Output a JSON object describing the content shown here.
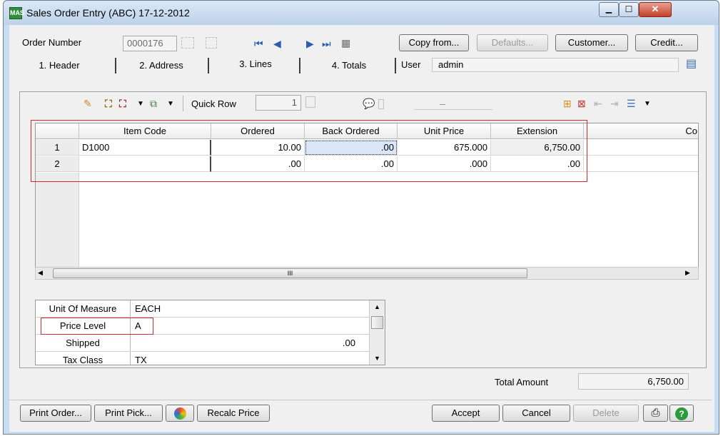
{
  "window": {
    "title": "Sales Order Entry (ABC) 17-12-2012",
    "app_icon": "MAS",
    "min_glyph": "▁",
    "max_glyph": "☐",
    "close_glyph": "✕"
  },
  "header": {
    "order_label": "Order Number",
    "order_number": "0000176",
    "buttons": {
      "copy_from": "Copy from...",
      "defaults": "Defaults...",
      "customer": "Customer...",
      "credit": "Credit..."
    },
    "user_label": "User",
    "user_value": "admin"
  },
  "tabs": [
    "1. Header",
    "2. Address",
    "3. Lines",
    "4. Totals"
  ],
  "toolbar": {
    "quick_row_label": "Quick Row",
    "quick_row_value": "1"
  },
  "lines": {
    "columns": [
      "",
      "Item Code",
      "Ordered",
      "Back Ordered",
      "Unit Price",
      "Extension",
      "Co"
    ],
    "rows": [
      {
        "num": "1",
        "item": "D1000",
        "ordered": "10.00",
        "back": ".00",
        "price": "675.000",
        "ext": "6,750.00"
      },
      {
        "num": "2",
        "item": "",
        "ordered": ".00",
        "back": ".00",
        "price": ".000",
        "ext": ".00"
      }
    ],
    "scroll_thumb": "III"
  },
  "properties": [
    {
      "label": "Unit Of Measure",
      "value": "EACH"
    },
    {
      "label": "Price Level",
      "value": "A"
    },
    {
      "label": "Shipped",
      "value": ".00"
    },
    {
      "label": "Tax Class",
      "value": "TX"
    }
  ],
  "totals": {
    "label": "Total Amount",
    "value": "6,750.00"
  },
  "footer": {
    "print_order": "Print Order...",
    "print_pick": "Print Pick...",
    "recalc": "Recalc Price",
    "accept": "Accept",
    "cancel": "Cancel",
    "delete": "Delete"
  },
  "colors": {
    "highlight_red": "#d22b2b",
    "selection_blue": "#dbe6f8",
    "title_bar": "#c9dcf1"
  }
}
